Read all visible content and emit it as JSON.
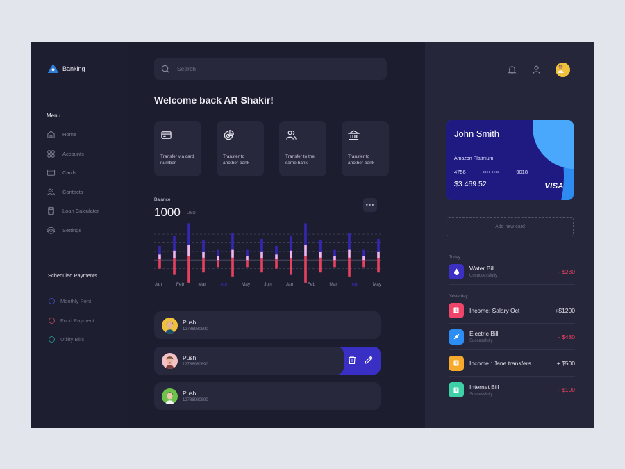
{
  "app": {
    "name": "Banking"
  },
  "sidebar": {
    "menu_title": "Menu",
    "items": [
      {
        "label": "Home",
        "icon": "home-icon"
      },
      {
        "label": "Accounts",
        "icon": "grid-icon"
      },
      {
        "label": "Cards",
        "icon": "card-icon"
      },
      {
        "label": "Contacts",
        "icon": "contacts-icon"
      },
      {
        "label": "Loan Calculator",
        "icon": "calculator-icon"
      },
      {
        "label": "Settings",
        "icon": "gear-icon"
      }
    ],
    "scheduled_title": "Scheduled Payments",
    "scheduled": [
      {
        "label": "Monthly Rent",
        "color": "#3b4bb8"
      },
      {
        "label": "Food Payment",
        "color": "#a3455a"
      },
      {
        "label": "Utility Bills",
        "color": "#2d8a85"
      }
    ]
  },
  "search": {
    "placeholder": "Search",
    "value": ""
  },
  "welcome": "Welcome back AR Shakir!",
  "quick_actions": [
    {
      "label": "Transfer via card number",
      "icon": "card-icon"
    },
    {
      "label": "Transfer to another bank",
      "icon": "pie-chart-icon"
    },
    {
      "label": "Transfer to the same bank",
      "icon": "users-icon"
    },
    {
      "label": "Transfer to another bank",
      "icon": "bank-icon"
    }
  ],
  "balance": {
    "label": "Balance",
    "value": "1000",
    "unit": "USD",
    "more": "•••"
  },
  "chart_data": {
    "type": "bar",
    "stacked": true,
    "x_labels": [
      "Jan",
      "Feb",
      "Mar",
      "Apr",
      "May",
      "Jun",
      "Jan",
      "Feb",
      "Mar",
      "Apr",
      "May"
    ],
    "highlighted_labels": [
      "Apr"
    ],
    "baseline": 0,
    "series": [
      {
        "name": "upper",
        "color": "#3526b4",
        "values": [
          11,
          19,
          28,
          16,
          8,
          21,
          8,
          16,
          11,
          19,
          28,
          16,
          8,
          21,
          8,
          16
        ]
      },
      {
        "name": "middle",
        "color": "#f1b4ef",
        "values": [
          6,
          10,
          14,
          7,
          5,
          10,
          5,
          9,
          6,
          10,
          14,
          7,
          5,
          10,
          5,
          9
        ]
      },
      {
        "name": "lower",
        "color": "#e8415f",
        "values": [
          -11,
          -19,
          -29,
          -16,
          -9,
          -21,
          -9,
          -16,
          -11,
          -19,
          -29,
          -16,
          -9,
          -21,
          -9,
          -16
        ]
      },
      {
        "name": "offset",
        "color": "#e8415f",
        "values": [
          1,
          2,
          5,
          3,
          0,
          3,
          0,
          2,
          1,
          2,
          5,
          3,
          0,
          3,
          0,
          2
        ]
      }
    ],
    "ylim": [
      -30,
      50
    ],
    "grid": "dashed-horizontal"
  },
  "contacts": [
    {
      "name": "Push",
      "number": "12788980890",
      "avatar_bg": "#f0c23b",
      "swiped": false
    },
    {
      "name": "Push",
      "number": "12788980890",
      "avatar_bg": "#f3c2c6",
      "swiped": true
    },
    {
      "name": "Push",
      "number": "12788980890",
      "avatar_bg": "#6cc24a",
      "swiped": false
    }
  ],
  "card": {
    "holder": "John Smith",
    "type": "Amazon Platinium",
    "number_first": "4756",
    "number_mask": "•••• ••••",
    "number_last": "9018",
    "balance": "$3.469.52",
    "brand": "VISA"
  },
  "add_card": "Add new card",
  "transactions": {
    "groups": [
      {
        "label": "Today",
        "items": [
          {
            "title": "Water Bill",
            "sub": "Unsuccessfully",
            "amount": "- $280",
            "type": "debit",
            "icon": "water-drop-icon",
            "color": "#3b2fc4"
          }
        ]
      },
      {
        "label": "Yesterday",
        "items": [
          {
            "title": "Income: Salary Oct",
            "sub": "",
            "amount": "+$1200",
            "type": "credit",
            "icon": "salary-icon",
            "color": "#f0456a"
          },
          {
            "title": "Electric Bill",
            "sub": "Successfully",
            "amount": "- $480",
            "type": "debit",
            "icon": "plug-icon",
            "color": "#2c8df5"
          },
          {
            "title": "Income : Jane transfers",
            "sub": "",
            "amount": "+ $500",
            "type": "credit",
            "icon": "transfer-icon",
            "color": "#f7a92c"
          },
          {
            "title": "Internet Bill",
            "sub": "Successfully",
            "amount": "- $100",
            "type": "debit",
            "icon": "internet-icon",
            "color": "#3ed1a7"
          }
        ]
      }
    ]
  },
  "colors": {
    "debit": "#e8415f",
    "credit": "#e2e2ec",
    "accent": "#3a2fc4"
  }
}
